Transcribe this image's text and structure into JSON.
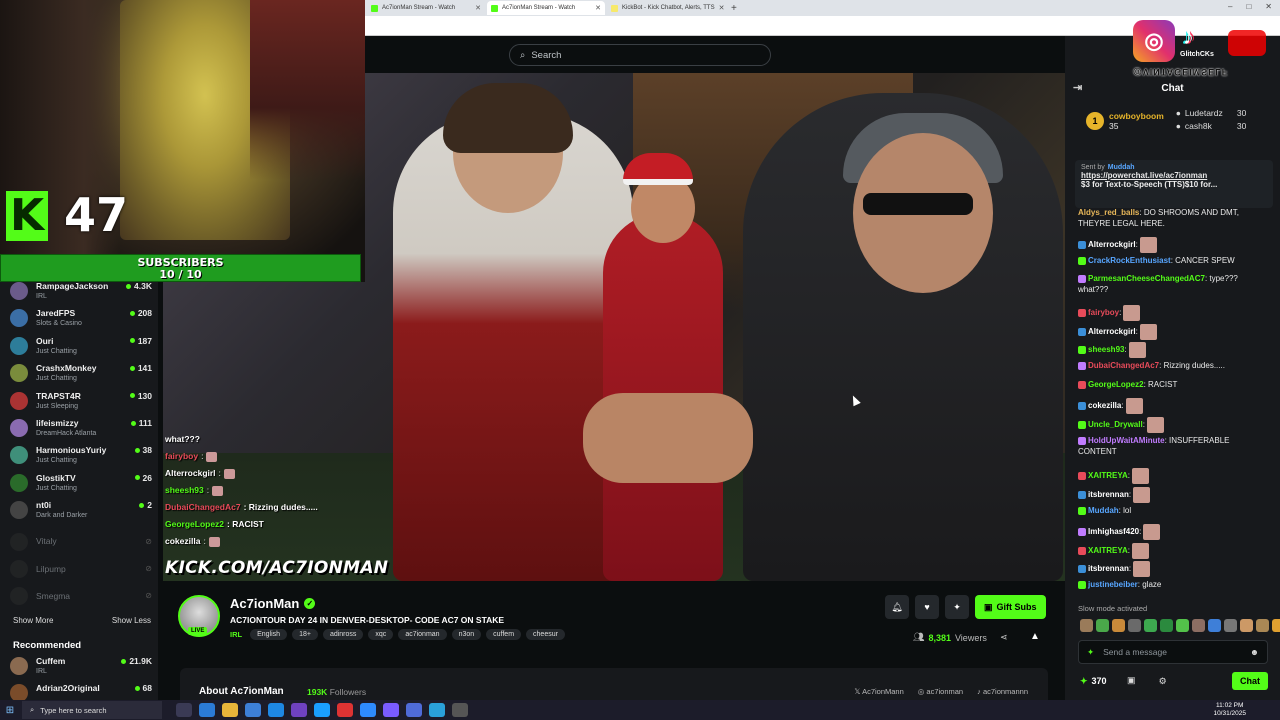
{
  "browser": {
    "tabs": [
      {
        "title": "Ac7ionMan Stream - Watch",
        "active": false
      },
      {
        "title": "Ac7ionMan Stream - Watch",
        "active": true
      },
      {
        "title": "KickBot - Kick Chatbot, Alerts, TTS",
        "active": false
      }
    ],
    "new_tab": "+",
    "controls": [
      "–",
      "□",
      "✕"
    ]
  },
  "overlay": {
    "sub_count": "47",
    "subs_label": "SUBSCRIBERS",
    "subs_progress": "10 / 10",
    "ig_handle": "@VINTAGEIMSELF",
    "dock_text": "GlitchCKs",
    "kick_url": "KICK.COM/AC7IONMAN"
  },
  "header": {
    "search_placeholder": "Search"
  },
  "sidebar": {
    "channels": [
      {
        "name": "RampageJackson",
        "category": "IRL",
        "viewers": "4.3K",
        "live": true
      },
      {
        "name": "JaredFPS",
        "category": "Slots & Casino",
        "viewers": "208",
        "live": true
      },
      {
        "name": "Ouri",
        "category": "Just Chatting",
        "viewers": "187",
        "live": true
      },
      {
        "name": "CrashxMonkey",
        "category": "Just Chatting",
        "viewers": "141",
        "live": true
      },
      {
        "name": "TRAPST4R",
        "category": "Just Sleeping",
        "viewers": "130",
        "live": true
      },
      {
        "name": "lifeismizzy",
        "category": "DreamHack Atlanta",
        "viewers": "111",
        "live": true
      },
      {
        "name": "HarmoniousYuriy",
        "category": "Just Chatting",
        "viewers": "38",
        "live": true
      },
      {
        "name": "GlostikTV",
        "category": "Just Chatting",
        "viewers": "26",
        "live": true
      },
      {
        "name": "nt0i",
        "category": "Dark and Darker",
        "viewers": "2",
        "live": true
      },
      {
        "name": "Vitaly",
        "category": "",
        "viewers": "",
        "live": false
      },
      {
        "name": "Lilpump",
        "category": "",
        "viewers": "",
        "live": false
      },
      {
        "name": "Smegma",
        "category": "",
        "viewers": "",
        "live": false
      }
    ],
    "show_more": "Show More",
    "show_less": "Show Less",
    "recommended_label": "Recommended",
    "recommended": [
      {
        "name": "Cuffem",
        "category": "IRL",
        "viewers": "21.9K"
      },
      {
        "name": "Adrian2Original",
        "category": "",
        "viewers": "68"
      }
    ]
  },
  "video_chat_overlay": [
    {
      "user": "",
      "text": "what???",
      "color": "#ffffff"
    },
    {
      "user": "fairyboy",
      "text": "",
      "color": "#e84b5a"
    },
    {
      "user": "Alterrockgirl",
      "text": "",
      "color": "#ffffff"
    },
    {
      "user": "sheesh93",
      "text": "",
      "color": "#53fc18"
    },
    {
      "user": "DubaiChangedAc7",
      "text": ": Rizzing dudes.....",
      "color": "#e84b5a"
    },
    {
      "user": "GeorgeLopez2",
      "text": ": RACIST",
      "color": "#53fc18"
    },
    {
      "user": "cokezilla",
      "text": "",
      "color": "#ffffff"
    }
  ],
  "stream": {
    "channel_name": "Ac7ionMan",
    "live_badge": "LIVE",
    "title": "AC7IONTOUR DAY 24 IN DENVER-DESKTOP- CODE AC7 ON STAKE",
    "category": "IRL",
    "tags": [
      "English",
      "18+",
      "adinross",
      "xqc",
      "ac7ionman",
      "n3on",
      "cuffem",
      "cheesur"
    ],
    "viewers": "8,381",
    "viewers_label": "Viewers",
    "gift_label": "Gift Subs",
    "about_label": "About Ac7ionMan",
    "followers": "193K",
    "followers_label": "Followers",
    "socials": [
      "Ac7ionMann",
      "ac7ionman",
      "ac7ionmannn"
    ]
  },
  "chat": {
    "title": "Chat",
    "leaderboard": [
      {
        "name": "cowboyboom",
        "points": "35"
      },
      {
        "name": "Ludetardz",
        "points": "30"
      },
      {
        "name": "cash8k",
        "points": "30"
      }
    ],
    "pinned": {
      "sent_by_label": "Sent by",
      "sent_by": "Muddah",
      "link": "https://powerchat.live/ac7ionman",
      "text": "$3 for Text-to-Speech (TTS)$10 for..."
    },
    "messages": [
      {
        "user": "Aldys_red_balls",
        "text": ": DO SHROOMS AND DMT, THEYRE LEGAL HERE.",
        "color": "#e8b85a"
      },
      {
        "user": "Alterrockgirl",
        "text": ":",
        "color": "#ffffff"
      },
      {
        "user": "CrackRockEnthusiast",
        "text": ": CANCER SPEW",
        "color": "#58a6ff"
      },
      {
        "user": "ParmesanCheeseChangedAC7",
        "text": ": type??? what???",
        "color": "#53fc18"
      },
      {
        "user": "fairyboy",
        "text": ":",
        "color": "#e84b5a"
      },
      {
        "user": "Alterrockgirl",
        "text": ":",
        "color": "#ffffff"
      },
      {
        "user": "sheesh93",
        "text": ":",
        "color": "#53fc18"
      },
      {
        "user": "DubaiChangedAc7",
        "text": ": Rizzing dudes.....",
        "color": "#e84b5a"
      },
      {
        "user": "GeorgeLopez2",
        "text": ": RACIST",
        "color": "#53fc18"
      },
      {
        "user": "cokezilla",
        "text": ":",
        "color": "#ffffff"
      },
      {
        "user": "Uncle_Drywall",
        "text": ":",
        "color": "#53fc18"
      },
      {
        "user": "HoldUpWaitAMinute",
        "text": ": INSUFFERABLE CONTENT",
        "color": "#c17cff"
      },
      {
        "user": "XAITREYA",
        "text": ":",
        "color": "#53fc18"
      },
      {
        "user": "itsbrennan",
        "text": ":",
        "color": "#ffffff"
      },
      {
        "user": "Muddah",
        "text": ": lol",
        "color": "#58a6ff"
      },
      {
        "user": "lmhighasf420",
        "text": ":",
        "color": "#ffffff"
      },
      {
        "user": "XAITREYA",
        "text": ":",
        "color": "#53fc18"
      },
      {
        "user": "itsbrennan",
        "text": ":",
        "color": "#ffffff"
      },
      {
        "user": "justinebeiber",
        "text": ": glaze",
        "color": "#58a6ff"
      }
    ],
    "slow_mode": "Slow mode activated",
    "input_placeholder": "Send a message",
    "points": "370",
    "chat_button": "Chat"
  },
  "taskbar": {
    "search_placeholder": "Type here to search",
    "time": "11:02 PM",
    "date": "10/31/2025"
  },
  "colors": {
    "accent": "#53fc18",
    "bg": "#0b0e0f",
    "panel": "#17191c"
  }
}
